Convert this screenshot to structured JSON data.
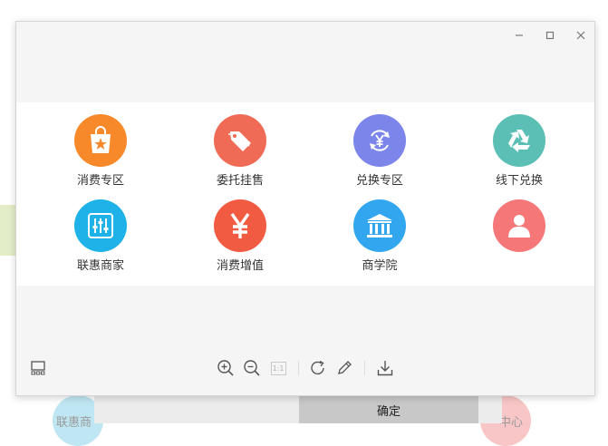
{
  "background": {
    "left_label": "联惠商",
    "right_label": "中心",
    "confirm_label": "确定"
  },
  "window_controls": [
    "minimize-icon",
    "maximize-icon",
    "close-icon"
  ],
  "image": {
    "items": [
      {
        "label": "消费专区",
        "icon": "shopping-bag-icon",
        "color": "#f7892b"
      },
      {
        "label": "委托挂售",
        "icon": "price-tag-icon",
        "color": "#ef6b55"
      },
      {
        "label": "兑换专区",
        "icon": "yuan-exchange-icon",
        "color": "#7c86ea"
      },
      {
        "label": "线下兑换",
        "icon": "recycle-icon",
        "color": "#5cbfb5"
      },
      {
        "label": "联惠商家",
        "icon": "equalizer-icon",
        "color": "#1fb2e8"
      },
      {
        "label": "消费增值",
        "icon": "yuan-icon",
        "color": "#f15b42"
      },
      {
        "label": "商学院",
        "icon": "institution-icon",
        "color": "#32a7ef"
      },
      {
        "label": "",
        "icon": "user-icon",
        "color": "#f67777"
      }
    ]
  },
  "toolbar": {
    "buttons": [
      "thumbnail-icon",
      "zoom-in-icon",
      "zoom-out-icon",
      "actual-size-icon",
      "rotate-icon",
      "edit-icon",
      "download-icon"
    ],
    "actual_size_label": "1:1"
  }
}
